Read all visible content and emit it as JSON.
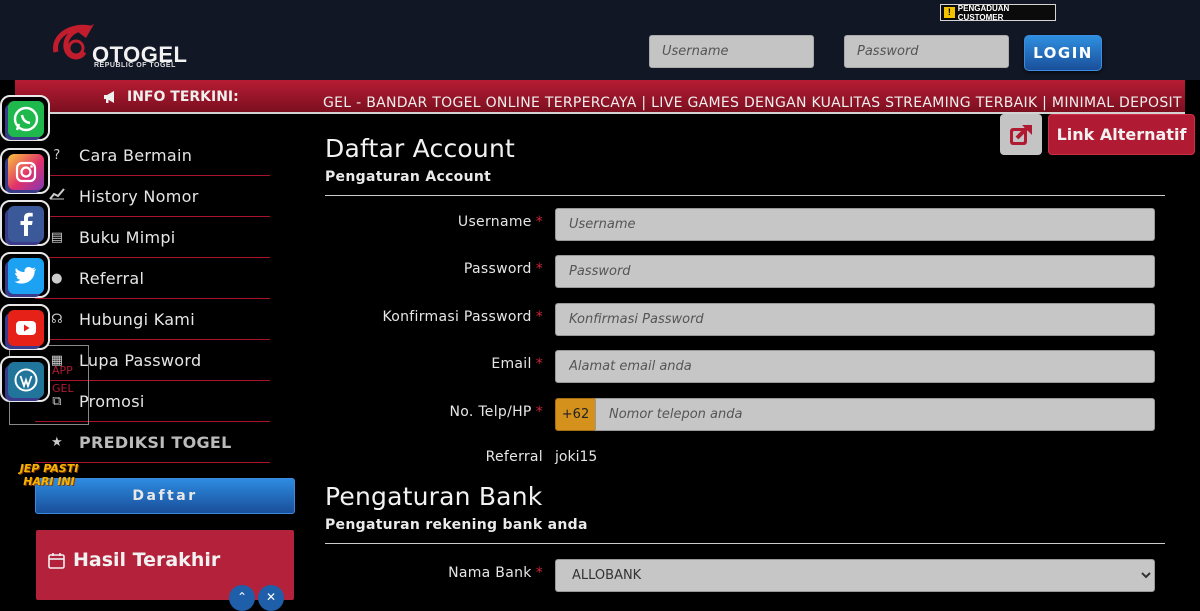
{
  "header": {
    "logo_text": "OTOGEL",
    "logo_sub": "REPUBLIC OF TOGEL",
    "complaint_label": "PENGADUAN CUSTOMER",
    "username_placeholder": "Username",
    "password_placeholder": "Password",
    "login_label": "LOGIN"
  },
  "ticker": {
    "label": "INFO TERKINI:",
    "text": "GEL - BANDAR TOGEL ONLINE TERPERCAYA | LIVE GAMES DENGAN KUALITAS STREAMING TERBAIK | MINIMAL DEPOSIT IDR"
  },
  "menu": {
    "items": [
      {
        "label": "Cara Bermain",
        "icon": "question-icon"
      },
      {
        "label": "History Nomor",
        "icon": "chart-line-icon"
      },
      {
        "label": "Buku Mimpi",
        "icon": "book-icon"
      },
      {
        "label": "Referral",
        "icon": "users-icon"
      },
      {
        "label": "Hubungi Kami",
        "icon": "headset-icon"
      },
      {
        "label": "Lupa Password",
        "icon": "calendar-icon"
      },
      {
        "label": "Promosi",
        "icon": "gift-icon"
      },
      {
        "label": "PREDIKSI TOGEL",
        "icon": "star-icon"
      }
    ],
    "daftar_label": "Daftar"
  },
  "overlay": {
    "wa_line1": "APP",
    "wa_line2": "GEL",
    "jp_text": "JEP PASTI HARI INI"
  },
  "hasil": {
    "title": "Hasil Terakhir"
  },
  "alt_link": {
    "label": "Link Alternatif"
  },
  "form": {
    "account_title": "Daftar Account",
    "account_sub": "Pengaturan Account",
    "fields": {
      "username": {
        "label": "Username",
        "placeholder": "Username"
      },
      "password": {
        "label": "Password",
        "placeholder": "Password"
      },
      "confirm": {
        "label": "Konfirmasi Password",
        "placeholder": "Konfirmasi Password"
      },
      "email": {
        "label": "Email",
        "placeholder": "Alamat email anda"
      },
      "phone": {
        "label": "No. Telp/HP",
        "placeholder": "Nomor telepon anda",
        "prefix": "+62"
      },
      "referral": {
        "label": "Referral",
        "value": "joki15"
      }
    },
    "required_mark": "*",
    "bank_title": "Pengaturan Bank",
    "bank_sub": "Pengaturan rekening bank anda",
    "bank_name": {
      "label": "Nama Bank",
      "value": "ALLOBANK"
    }
  },
  "colors": {
    "accent_red": "#b01a33",
    "accent_blue": "#1a4f9a",
    "header_bg": "#121726"
  }
}
